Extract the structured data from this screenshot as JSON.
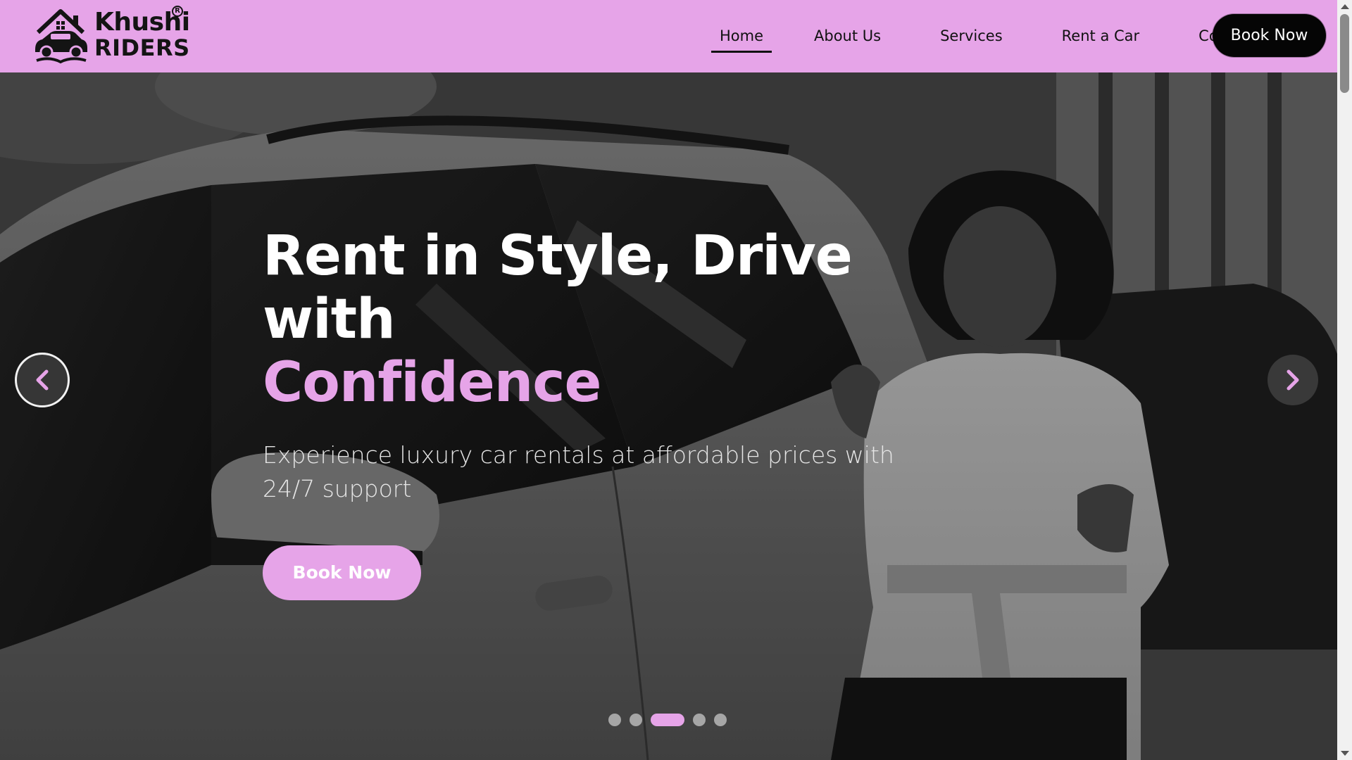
{
  "brand": {
    "name_line1": "Khushi",
    "name_line2": "RIDERS",
    "registered_mark": "R",
    "emblem_text": "Khushi riders",
    "accent_color": "#e6a4e8"
  },
  "nav": {
    "items": [
      {
        "label": "Home",
        "active": true
      },
      {
        "label": "About Us",
        "active": false
      },
      {
        "label": "Services",
        "active": false
      },
      {
        "label": "Rent a Car",
        "active": false
      },
      {
        "label": "Contact",
        "active": false
      }
    ],
    "cta_label": "Book Now"
  },
  "hero": {
    "title_main": "Rent in Style, Drive with",
    "title_accent": "Confidence",
    "subtitle": "Experience luxury car rentals at affordable prices with 24/7 support",
    "cta_label": "Book Now",
    "prev_icon": "chevron-left-icon",
    "next_icon": "chevron-right-icon"
  },
  "carousel": {
    "slide_count": 5,
    "active_index": 2
  }
}
